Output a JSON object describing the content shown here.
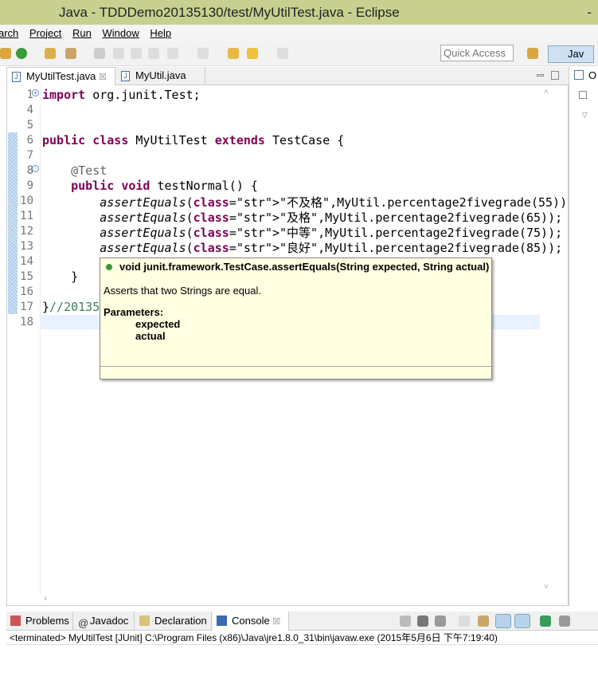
{
  "window": {
    "title": "Java - TDDDemo20135130/test/MyUtilTest.java - Eclipse",
    "minimize": "-"
  },
  "menu": [
    "arch",
    "Project",
    "Run",
    "Window",
    "Help"
  ],
  "toolbar": {
    "quick_access_placeholder": "Quick Access",
    "perspective": "Jav"
  },
  "editor": {
    "tabs": [
      {
        "label": "MyUtilTest.java",
        "close": "☒",
        "active": true
      },
      {
        "label": "MyUtil.java",
        "active": false
      }
    ],
    "lines": [
      {
        "n": "1",
        "t": "import org.junit.Test;"
      },
      {
        "n": "4",
        "t": ""
      },
      {
        "n": "5",
        "t": ""
      },
      {
        "n": "6",
        "t": "public class MyUtilTest extends TestCase {"
      },
      {
        "n": "7",
        "t": ""
      },
      {
        "n": "8",
        "t": "    @Test"
      },
      {
        "n": "9",
        "t": "    public void testNormal() {"
      },
      {
        "n": "10",
        "t": "        assertEquals(\"不及格\",MyUtil.percentage2fivegrade(55));"
      },
      {
        "n": "11",
        "t": "        assertEquals(\"及格\",MyUtil.percentage2fivegrade(65));"
      },
      {
        "n": "12",
        "t": "        assertEquals(\"中等\",MyUtil.percentage2fivegrade(75));"
      },
      {
        "n": "13",
        "t": "        assertEquals(\"良好\",MyUtil.percentage2fivegrade(85));"
      },
      {
        "n": "14",
        "t": ""
      },
      {
        "n": "15",
        "t": "    }"
      },
      {
        "n": "16",
        "t": ""
      },
      {
        "n": "17",
        "t": "}//20135"
      },
      {
        "n": "18",
        "t": ""
      }
    ]
  },
  "hover": {
    "signature": "void junit.framework.TestCase.assertEquals(String expected, String actual)",
    "description": "Asserts that two Strings are equal.",
    "params_heading": "Parameters:",
    "params": [
      "expected",
      "actual"
    ]
  },
  "right_panel": {
    "label": "O"
  },
  "bottom": {
    "tabs": [
      {
        "label": "Problems"
      },
      {
        "label": "Javadoc"
      },
      {
        "label": "Declaration"
      },
      {
        "label": "Console",
        "active": true,
        "close": "☒"
      }
    ],
    "console_status": "<terminated> MyUtilTest [JUnit] C:\\Program Files (x86)\\Java\\jre1.8.0_31\\bin\\javaw.exe (2015年5月6日 下午7:19:40)"
  }
}
